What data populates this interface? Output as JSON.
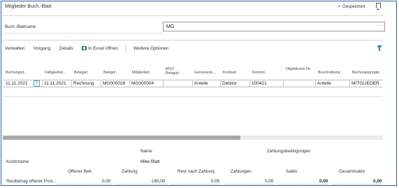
{
  "header": {
    "title": "Mitglieder Buch.-Blatt",
    "saved_label": "Gespeichert"
  },
  "batch": {
    "label": "Buch.-Blattname",
    "value": "MG"
  },
  "toolbar": {
    "items": [
      "Verwalten",
      "Vorgang",
      "Details",
      "In Excel öffnen",
      "Weitere Optionen"
    ]
  },
  "table": {
    "columns": [
      "Buchungsd...",
      "Fälligkeitsd...",
      "Belegart",
      "Belegnr.",
      "Mitgliedsnr.",
      "MGV Belegart",
      "Genossens...",
      "Kontoart",
      "Kontonr.",
      "Objektkonto Nr.",
      "Beschreibung",
      "Buchungsgruppe"
    ],
    "rows": [
      [
        "11.11.2021",
        "11.11.2021",
        "Rechnung",
        "MG000028",
        "MG000004",
        "",
        "Anteile",
        "Debitor",
        "100421",
        "",
        "Anteile",
        "MITGLIEDER"
      ]
    ]
  },
  "footer": {
    "name_label": "Name",
    "payment_terms_label": "Zahlungsbedingungen",
    "account_name_label": "Kontoname",
    "account_name_value": "Mike Blatt",
    "headers": [
      "Offener Betr.",
      "Zahlung",
      "Rest nach Zahlung",
      "Zahlungen",
      "Saldo",
      "Gesamtsaldo"
    ],
    "row_label": "Restbetrag offener Post...",
    "values": [
      "0,00",
      "-150,00",
      "0,00",
      "0,00",
      "0,00",
      "0,00"
    ]
  },
  "colors": {
    "frame_border": "#2f5da8",
    "accent": "#2a8a9d",
    "excel": "#217346"
  }
}
